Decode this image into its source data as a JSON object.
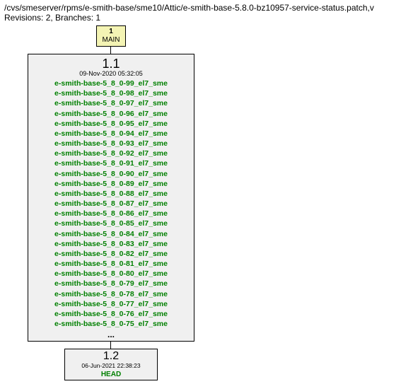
{
  "header": {
    "path": "/cvs/smeserver/rpms/e-smith-base/sme10/Attic/e-smith-base-5.8.0-bz10957-service-status.patch,v",
    "rev_line": "Revisions: 2, Branches: 1"
  },
  "branch_head": {
    "num": "1",
    "label": "MAIN"
  },
  "rev1": {
    "ver": "1.1",
    "date": "09-Nov-2020 05:32:05",
    "tags": [
      "e-smith-base-5_8_0-99_el7_sme",
      "e-smith-base-5_8_0-98_el7_sme",
      "e-smith-base-5_8_0-97_el7_sme",
      "e-smith-base-5_8_0-96_el7_sme",
      "e-smith-base-5_8_0-95_el7_sme",
      "e-smith-base-5_8_0-94_el7_sme",
      "e-smith-base-5_8_0-93_el7_sme",
      "e-smith-base-5_8_0-92_el7_sme",
      "e-smith-base-5_8_0-91_el7_sme",
      "e-smith-base-5_8_0-90_el7_sme",
      "e-smith-base-5_8_0-89_el7_sme",
      "e-smith-base-5_8_0-88_el7_sme",
      "e-smith-base-5_8_0-87_el7_sme",
      "e-smith-base-5_8_0-86_el7_sme",
      "e-smith-base-5_8_0-85_el7_sme",
      "e-smith-base-5_8_0-84_el7_sme",
      "e-smith-base-5_8_0-83_el7_sme",
      "e-smith-base-5_8_0-82_el7_sme",
      "e-smith-base-5_8_0-81_el7_sme",
      "e-smith-base-5_8_0-80_el7_sme",
      "e-smith-base-5_8_0-79_el7_sme",
      "e-smith-base-5_8_0-78_el7_sme",
      "e-smith-base-5_8_0-77_el7_sme",
      "e-smith-base-5_8_0-76_el7_sme",
      "e-smith-base-5_8_0-75_el7_sme"
    ],
    "ellipsis": "..."
  },
  "rev2": {
    "ver": "1.2",
    "date": "06-Jun-2021 22:38:23",
    "head": "HEAD"
  }
}
